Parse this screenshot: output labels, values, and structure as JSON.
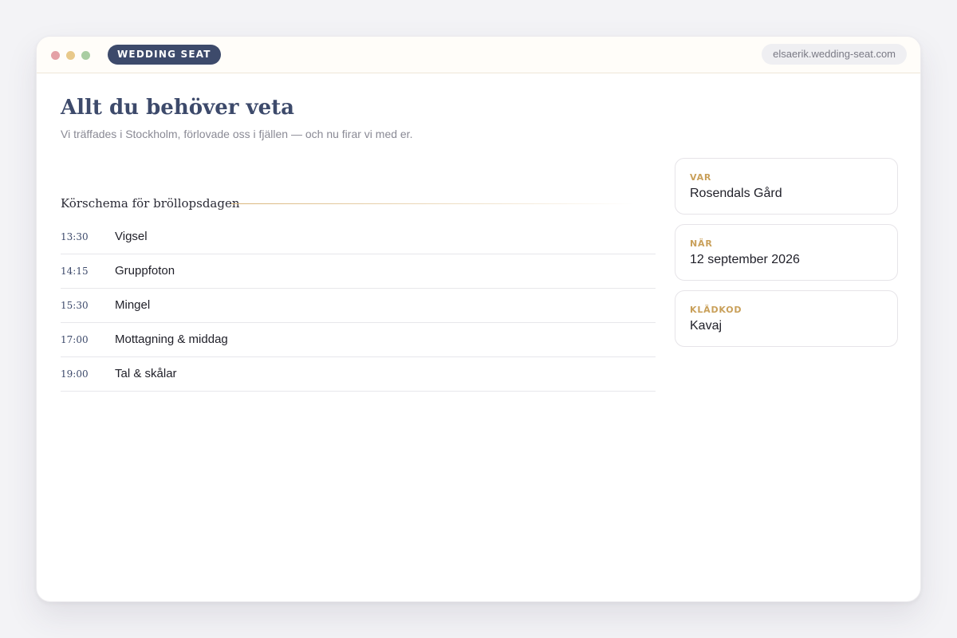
{
  "brand": "WEDDING SEAT",
  "url": "elsaerik.wedding-seat.com",
  "page": {
    "title": "Allt du behöver veta",
    "subtitle": "Vi träffades i Stockholm, förlovade oss i fjällen — och nu firar vi med er."
  },
  "schedule": {
    "heading": "Körschema för bröllopsdagen",
    "items": [
      {
        "time": "13:30",
        "label": "Vigsel"
      },
      {
        "time": "14:15",
        "label": "Gruppfoton"
      },
      {
        "time": "15:30",
        "label": "Mingel"
      },
      {
        "time": "17:00",
        "label": "Mottagning & middag"
      },
      {
        "time": "19:00",
        "label": "Tal & skålar"
      }
    ]
  },
  "info_cards": [
    {
      "label": "VAR",
      "value": "Rosendals Gård"
    },
    {
      "label": "NÄR",
      "value": "12 september 2026"
    },
    {
      "label": "KLÄDKOD",
      "value": "Kavaj"
    }
  ],
  "colors": {
    "brand": "#3d4a6b",
    "accent": "#c9a05a",
    "window_close": "#e4a1a6",
    "window_minimize": "#e8c98a",
    "window_maximize": "#a9cda2"
  }
}
